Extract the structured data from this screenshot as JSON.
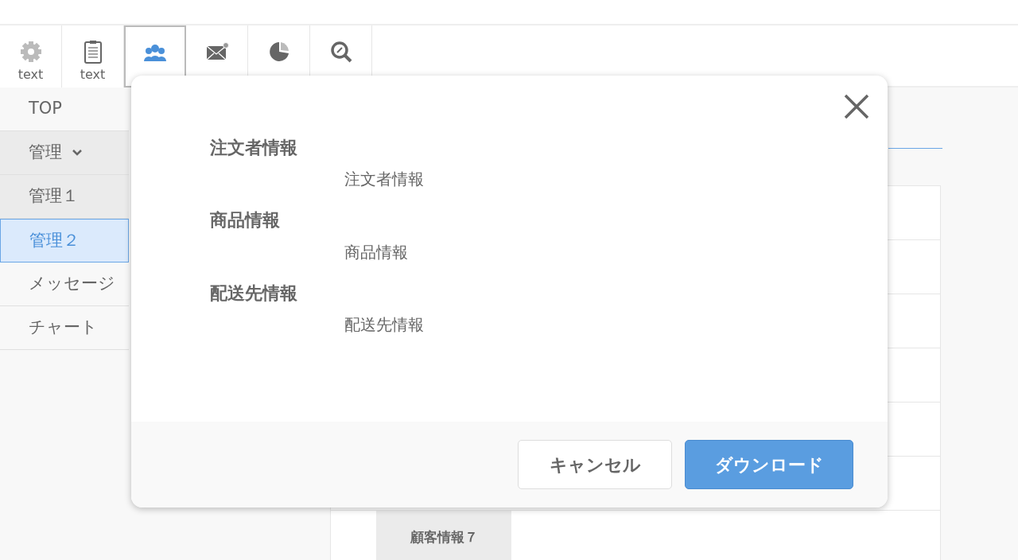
{
  "toolbar": [
    {
      "label": "text",
      "selected": false
    },
    {
      "label": "text",
      "selected": false
    },
    {
      "selected": true
    },
    {
      "selected": false
    },
    {
      "selected": false
    },
    {
      "selected": false
    }
  ],
  "sidebar": {
    "items": [
      {
        "label": "TOP",
        "selected": false
      },
      {
        "label": "管理",
        "selected": false,
        "expanded": true,
        "children": [
          {
            "label": "管理１",
            "selected": false
          },
          {
            "label": "管理２",
            "selected": true
          }
        ]
      },
      {
        "label": "メッセージ",
        "selected": false
      },
      {
        "label": "チャート",
        "selected": false
      }
    ]
  },
  "table": {
    "visible_cell": "顧客情報７"
  },
  "dialog": {
    "sections": [
      {
        "heading": "注文者情報",
        "item": "注文者情報"
      },
      {
        "heading": "商品情報",
        "item": "商品情報"
      },
      {
        "heading": "配送先情報",
        "item": "配送先情報"
      }
    ],
    "buttons": [
      {
        "label": "キャンセル",
        "kind": "secondary"
      },
      {
        "label": "ダウンロード",
        "kind": "primary"
      }
    ]
  }
}
